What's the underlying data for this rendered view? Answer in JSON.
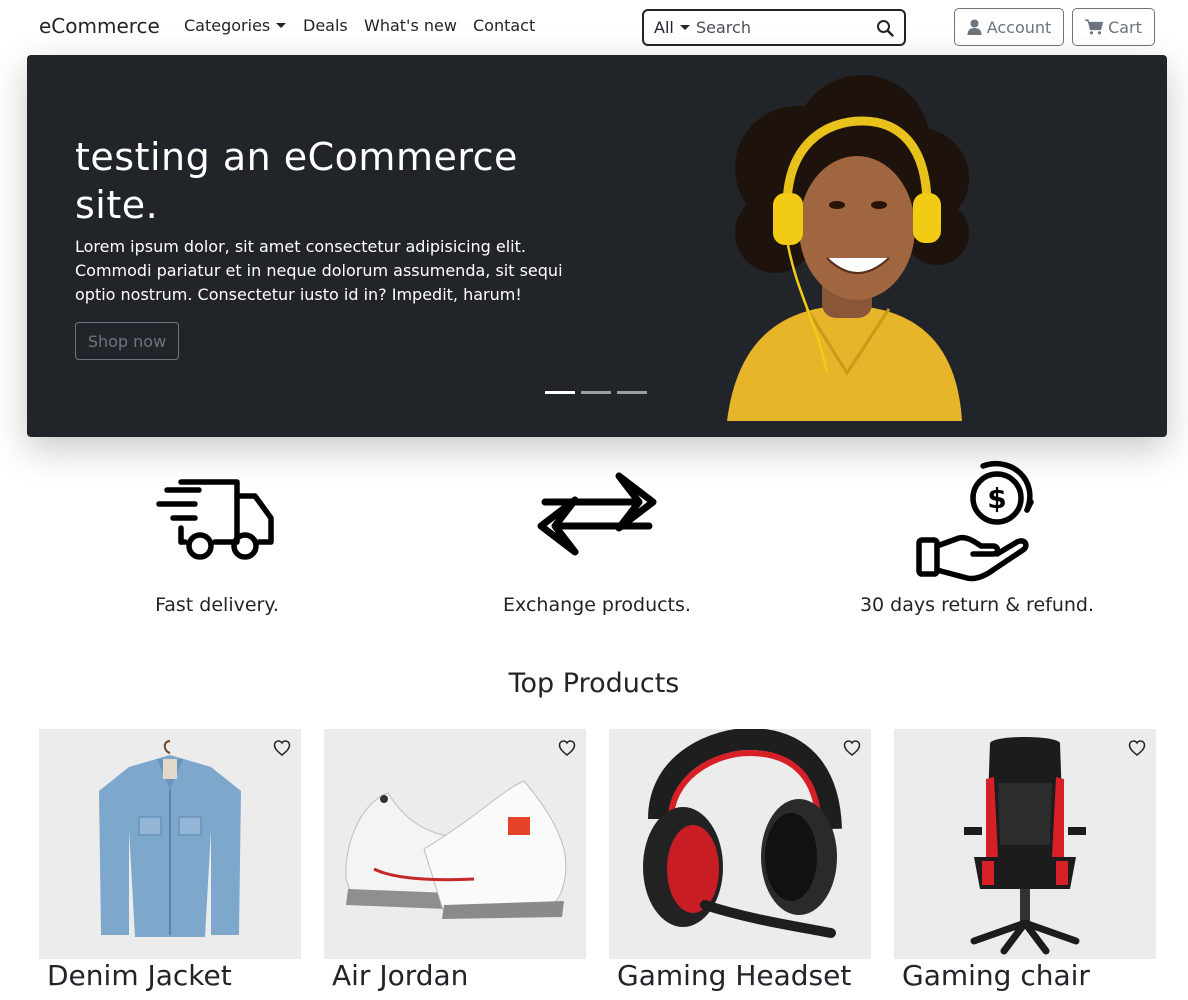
{
  "navbar": {
    "brand": "eCommerce",
    "links": [
      "Categories",
      "Deals",
      "What's new",
      "Contact"
    ],
    "search": {
      "category": "All",
      "placeholder": "Search"
    },
    "account_label": "Account",
    "cart_label": "Cart"
  },
  "hero": {
    "title": "testing an eCommerce site.",
    "text": "Lorem ipsum dolor, sit amet consectetur adipisicing elit. Commodi pariatur et in neque dolorum assumenda, sit sequi optio nostrum. Consectetur iusto id in? Impedit, harum!",
    "button": "Shop now",
    "slide_count": 3,
    "active_slide": 1
  },
  "features": [
    {
      "icon": "delivery-truck-icon",
      "label": "Fast delivery."
    },
    {
      "icon": "exchange-arrows-icon",
      "label": "Exchange products."
    },
    {
      "icon": "hand-dollar-coin-icon",
      "label": "30 days return & refund."
    }
  ],
  "top_products": {
    "title": "Top Products",
    "items": [
      {
        "name": "Denim Jacket",
        "icon": "denim-jacket-image"
      },
      {
        "name": "Air Jordan",
        "icon": "sneakers-image"
      },
      {
        "name": "Gaming Headset",
        "icon": "headset-image"
      },
      {
        "name": "Gaming chair",
        "icon": "gaming-chair-image"
      }
    ]
  },
  "colors": {
    "dark": "#212529",
    "muted": "#6c757d",
    "card_bg": "#ececec",
    "accent_red": "#d61f26",
    "hero_yellow": "#e8b81c"
  }
}
